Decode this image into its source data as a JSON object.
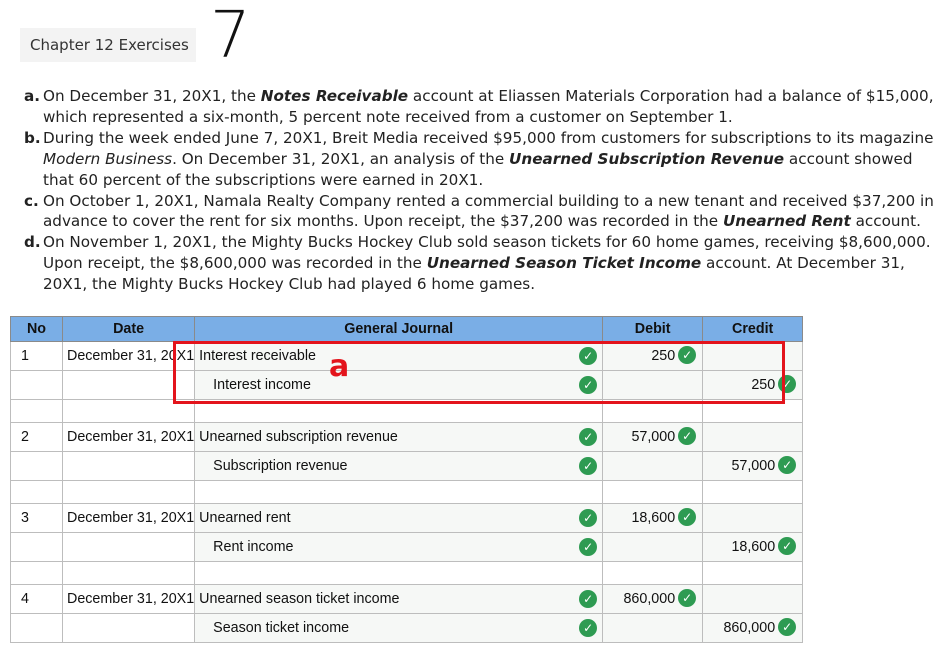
{
  "header": {
    "chapter": "Chapter 12 Exercises",
    "exercise_number": "7"
  },
  "problems": [
    {
      "letter": "a.",
      "p1": "On December 31, 20X1, the ",
      "acct": "Notes Receivable",
      "p2": " account at Eliassen Materials Corporation had a balance of $15,000, which represented a six-month, 5 percent note received from a customer on September 1."
    },
    {
      "letter": "b.",
      "p1": "During the week ended June 7, 20X1, Breit Media received $95,000 from customers for subscriptions to its magazine ",
      "mag": "Modern Business",
      "p2": ". On December 31, 20X1, an analysis of the ",
      "acct": "Unearned Subscription Revenue",
      "p3": " account showed that 60 percent of the subscriptions were earned in 20X1."
    },
    {
      "letter": "c.",
      "p1": "On October 1, 20X1, Namala Realty Company rented a commercial building to a new tenant and received $37,200 in advance to cover the rent for six months. Upon receipt, the $37,200 was recorded in the ",
      "acct": "Unearned Rent",
      "p2": " account."
    },
    {
      "letter": "d.",
      "p1": "On November 1, 20X1, the Mighty Bucks Hockey Club sold season tickets for 60 home games, receiving $8,600,000. Upon receipt, the $8,600,000 was recorded in the ",
      "acct": "Unearned Season Ticket Income",
      "p2": " account. At December 31, 20X1, the Mighty Bucks Hockey Club had played 6 home games."
    }
  ],
  "journal": {
    "headers": {
      "no": "No",
      "date": "Date",
      "journal": "General Journal",
      "debit": "Debit",
      "credit": "Credit"
    },
    "entries": [
      {
        "no": "1",
        "date": "December 31, 20X1",
        "debit_account": "Interest receivable",
        "credit_account": "Interest income",
        "debit": "250",
        "credit": "250"
      },
      {
        "no": "2",
        "date": "December 31, 20X1",
        "debit_account": "Unearned subscription revenue",
        "credit_account": "Subscription revenue",
        "debit": "57,000",
        "credit": "57,000"
      },
      {
        "no": "3",
        "date": "December 31, 20X1",
        "debit_account": "Unearned rent",
        "credit_account": "Rent income",
        "debit": "18,600",
        "credit": "18,600"
      },
      {
        "no": "4",
        "date": "December 31, 20X1",
        "debit_account": "Unearned season ticket income",
        "credit_account": "Season ticket income",
        "debit": "860,000",
        "credit": "860,000"
      }
    ]
  },
  "annotation": {
    "label": "a",
    "color": "#e3141c"
  },
  "colors": {
    "header_blue": "#7aaee6",
    "check_green": "#2e9b52"
  },
  "icons": {
    "check": "✓"
  }
}
